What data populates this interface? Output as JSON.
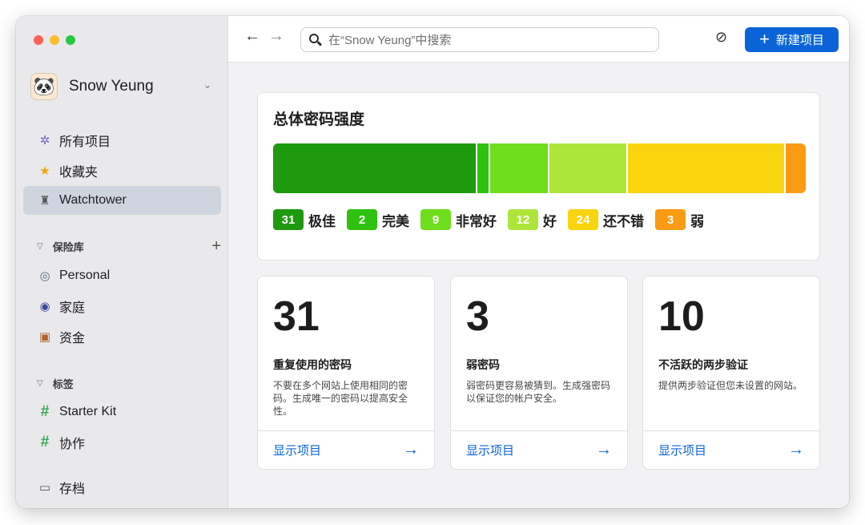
{
  "sidebar": {
    "account_name": "Snow Yeung",
    "avatar_glyph": "🐼",
    "nav": [
      {
        "label": "所有项目",
        "icon": "✲"
      },
      {
        "label": "收藏夹",
        "icon": "★"
      },
      {
        "label": "Watchtower",
        "icon": "♜"
      }
    ],
    "vaults_header": "保险库",
    "vaults_add": "+",
    "vaults": [
      {
        "label": "Personal",
        "icon": "◎"
      },
      {
        "label": "家庭",
        "icon": "◉"
      },
      {
        "label": "资金",
        "icon": "▣"
      }
    ],
    "tags_header": "标签",
    "tags": [
      {
        "label": "Starter Kit",
        "icon": "#"
      },
      {
        "label": "协作",
        "icon": "#"
      }
    ],
    "archive": {
      "label": "存档",
      "icon": "▭"
    }
  },
  "toolbar": {
    "back_arrow": "←",
    "forward_arrow": "→",
    "search_placeholder": "在“Snow Yeung”中搜索",
    "hide_icon": "⊘",
    "new_item_label": "新建项目",
    "new_item_plus": "+"
  },
  "strength": {
    "title": "总体密码强度",
    "levels": [
      {
        "count": "31",
        "label": "极佳",
        "color": "#1e9a0f"
      },
      {
        "count": "2",
        "label": "完美",
        "color": "#2fc10f"
      },
      {
        "count": "9",
        "label": "非常好",
        "color": "#6fde1c"
      },
      {
        "count": "12",
        "label": "好",
        "color": "#ade53a"
      },
      {
        "count": "24",
        "label": "还不错",
        "color": "#fad40f"
      },
      {
        "count": "3",
        "label": "弱",
        "color": "#fb9a13"
      }
    ]
  },
  "cards": [
    {
      "number": "31",
      "title": "重复使用的密码",
      "desc": "不要在多个网站上使用相同的密码。生成唯一的密码以提高安全性。",
      "link": "显示项目",
      "arrow": "→"
    },
    {
      "number": "3",
      "title": "弱密码",
      "desc": "弱密码更容易被猜到。生成强密码以保证您的帐户安全。",
      "link": "显示项目",
      "arrow": "→"
    },
    {
      "number": "10",
      "title": "不活跃的两步验证",
      "desc": "提供两步验证但您未设置的网站。",
      "link": "显示项目",
      "arrow": "→"
    }
  ]
}
